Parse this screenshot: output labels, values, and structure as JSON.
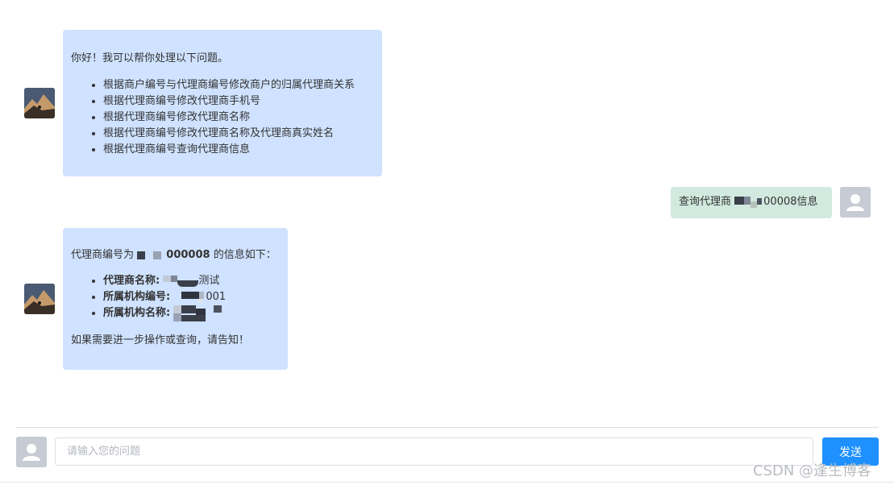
{
  "messages": {
    "bot1": {
      "greeting": "你好！我可以帮你处理以下问题。",
      "items": [
        "根据商户编号与代理商编号修改商户的归属代理商关系",
        "根据代理商编号修改代理商手机号",
        "根据代理商编号修改代理商名称",
        "根据代理商编号修改代理商名称及代理商真实姓名",
        "根据代理商编号查询代理商信息"
      ]
    },
    "user1": {
      "prefix": "查询代理商",
      "suffix": "00008信息"
    },
    "bot2": {
      "intro_prefix": "代理商编号为",
      "intro_number": "000008",
      "intro_suffix": "的信息如下：",
      "field1_label": "代理商名称:",
      "field1_value_suffix": "测试",
      "field2_label": "所属机构编号:",
      "field2_value_suffix": "001",
      "field3_label": "所属机构名称:",
      "closing": "如果需要进一步操作或查询，请告知！"
    }
  },
  "composer": {
    "placeholder": "请输入您的问题",
    "send_label": "发送"
  },
  "watermark": "CSDN @逢生博客",
  "icons": {
    "bot_avatar": "mountain-photo-avatar",
    "user_avatar": "user-silhouette-icon"
  }
}
